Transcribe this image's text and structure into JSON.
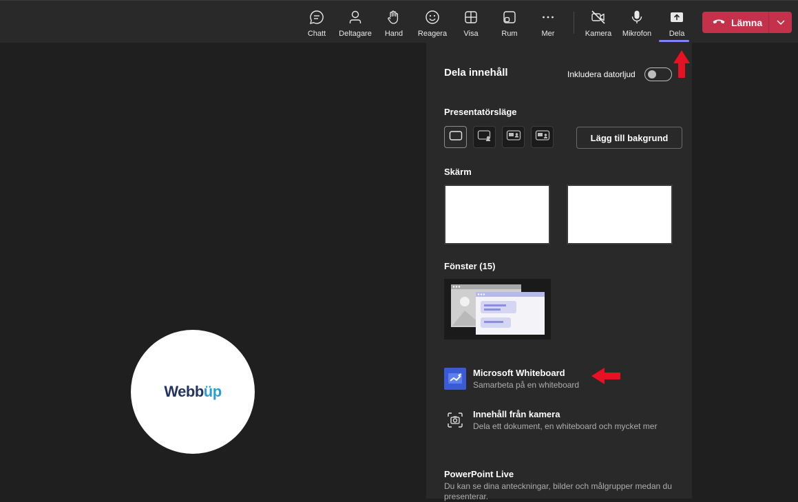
{
  "toolbar": {
    "items": [
      {
        "label": "Chatt",
        "icon": "chat-icon"
      },
      {
        "label": "Deltagare",
        "icon": "people-icon"
      },
      {
        "label": "Hand",
        "icon": "hand-icon"
      },
      {
        "label": "Reagera",
        "icon": "smiley-icon"
      },
      {
        "label": "Visa",
        "icon": "view-grid-icon"
      },
      {
        "label": "Rum",
        "icon": "rooms-icon"
      },
      {
        "label": "Mer",
        "icon": "more-icon"
      },
      {
        "label": "Kamera",
        "icon": "camera-off-icon"
      },
      {
        "label": "Mikrofon",
        "icon": "microphone-icon"
      },
      {
        "label": "Dela",
        "icon": "share-icon",
        "active": true
      }
    ],
    "leave_label": "Lämna",
    "accent_color": "#7f85f5",
    "leave_color": "#c4314b"
  },
  "participant": {
    "logo_part1": "Webb",
    "logo_part2": "üp"
  },
  "share_panel": {
    "title": "Dela innehåll",
    "include_audio_label": "Inkludera datorljud",
    "include_audio_on": false,
    "presenter_mode_heading": "Presentatörsläge",
    "add_background_label": "Lägg till bakgrund",
    "screen_heading": "Skärm",
    "windows_heading": "Fönster (15)",
    "whiteboard": {
      "title": "Microsoft Whiteboard",
      "subtitle": "Samarbeta på en whiteboard"
    },
    "camera_content": {
      "title": "Innehåll från kamera",
      "subtitle": "Dela ett dokument, en whiteboard och mycket mer"
    },
    "powerpoint": {
      "title": "PowerPoint Live",
      "description": "Du kan se dina anteckningar, bilder och målgrupper medan du presenterar."
    }
  },
  "annotation_color": "#e81123"
}
